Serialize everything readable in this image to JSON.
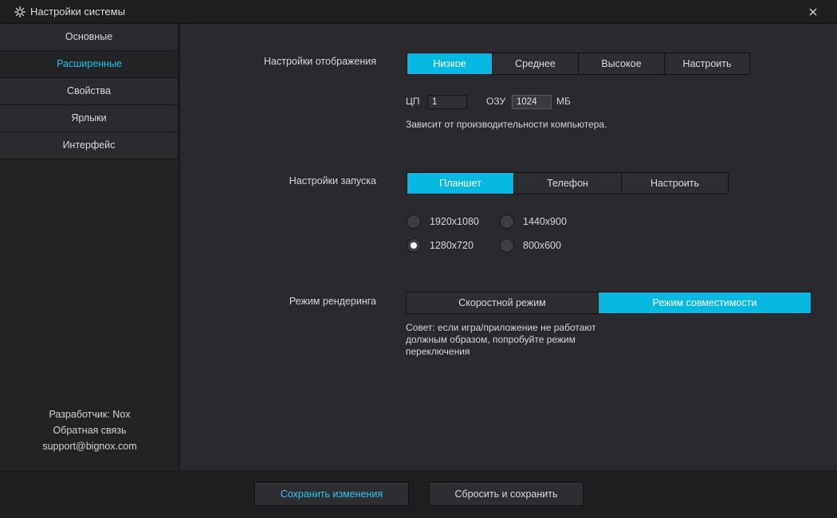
{
  "window": {
    "title": "Настройки системы",
    "close_icon": "close-icon",
    "title_icon": "gear-icon"
  },
  "sidebar": {
    "items": [
      {
        "label": "Основные",
        "active": false
      },
      {
        "label": "Расширенные",
        "active": true
      },
      {
        "label": "Свойства",
        "active": false
      },
      {
        "label": "Ярлыки",
        "active": false
      },
      {
        "label": "Интерфейс",
        "active": false
      }
    ],
    "developer": "Разработчик: Nox",
    "feedback": "Обратная связь",
    "email": "support@bignox.com"
  },
  "display": {
    "label": "Настройки отображения",
    "options": [
      "Низкое",
      "Среднее",
      "Высокое",
      "Настроить"
    ],
    "selected": "Низкое",
    "cpu_label": "ЦП",
    "cpu_value": "1",
    "ram_label": "ОЗУ",
    "ram_value": "1024",
    "ram_unit": "МБ",
    "note": "Зависит от производительности компьютера."
  },
  "startup": {
    "label": "Настройки запуска",
    "options": [
      "Планшет",
      "Телефон",
      "Настроить"
    ],
    "selected": "Планшет",
    "resolutions": [
      {
        "label": "1920x1080",
        "checked": false
      },
      {
        "label": "1440x900",
        "checked": false
      },
      {
        "label": "1280x720",
        "checked": true
      },
      {
        "label": "800x600",
        "checked": false
      }
    ]
  },
  "render": {
    "label": "Режим рендеринга",
    "options": [
      "Скоростной режим",
      "Режим совместимости"
    ],
    "selected": "Режим совместимости",
    "tip_line1": "Совет: если игра/приложение не работают",
    "tip_line2": "должным образом, попробуйте режим",
    "tip_line3": "переключения"
  },
  "footer": {
    "save_label": "Сохранить изменения",
    "reset_label": "Сбросить и сохранить"
  },
  "colors": {
    "accent": "#07b9e0",
    "accent_text": "#1ec2e6",
    "background": "#2a2a2e",
    "sidebar": "#232326"
  }
}
